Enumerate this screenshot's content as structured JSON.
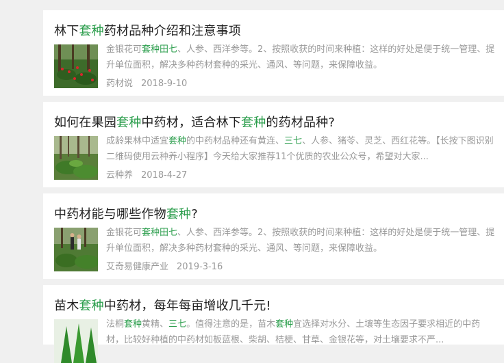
{
  "results": [
    {
      "title_parts": [
        {
          "t": "林下",
          "hl": false
        },
        {
          "t": "套种",
          "hl": true
        },
        {
          "t": "药材品种介绍和注意事项",
          "hl": false
        }
      ],
      "desc_parts": [
        {
          "t": "金银花可",
          "hl": false
        },
        {
          "t": "套种田七",
          "hl": true
        },
        {
          "t": "、人参、西洋参等。2、按照收获的时间来种植：这样的好处是便于统一管理、提升单位面积，解决多种药材套种的采光、通风、等问题，来保障收益。",
          "hl": false
        }
      ],
      "source": "药材说",
      "date": "2018-9-10",
      "thumb": "forest-redflowers"
    },
    {
      "title_parts": [
        {
          "t": "如何在果园",
          "hl": false
        },
        {
          "t": "套种",
          "hl": true
        },
        {
          "t": "中药材，适合林下",
          "hl": false
        },
        {
          "t": "套种",
          "hl": true
        },
        {
          "t": "的药材品种?",
          "hl": false
        }
      ],
      "desc_parts": [
        {
          "t": "成龄果林中适宜",
          "hl": false
        },
        {
          "t": "套种",
          "hl": true
        },
        {
          "t": "的中药材品种还有黄连、",
          "hl": false
        },
        {
          "t": "三七",
          "hl": true
        },
        {
          "t": "、人参、猪苓、灵芝、西红花等。【长按下图识别二维码使用云种养小程序】今天给大家推荐11个优质的农业公众号，希望对大家...",
          "hl": false
        }
      ],
      "source": "云种养",
      "date": "2018-4-27",
      "thumb": "forest-plants"
    },
    {
      "title_parts": [
        {
          "t": "中药材能与哪些作物",
          "hl": false
        },
        {
          "t": "套种",
          "hl": true
        },
        {
          "t": "?",
          "hl": false
        }
      ],
      "desc_parts": [
        {
          "t": "金银花可",
          "hl": false
        },
        {
          "t": "套种田七",
          "hl": true
        },
        {
          "t": "、人参、西洋参等。2、按照收获的时间来种植：这样的好处是便于统一管理、提升单位面积，解决多种药材套种的采光、通风、等问题，来保障收益。",
          "hl": false
        }
      ],
      "source": "艾奇易健康产业",
      "date": "2019-3-16",
      "thumb": "forest-people"
    },
    {
      "title_parts": [
        {
          "t": "苗木",
          "hl": false
        },
        {
          "t": "套种",
          "hl": true
        },
        {
          "t": "中药材，每年每亩增收几千元!",
          "hl": false
        }
      ],
      "desc_parts": [
        {
          "t": "法桐",
          "hl": false
        },
        {
          "t": "套种",
          "hl": true
        },
        {
          "t": "黄精、",
          "hl": false
        },
        {
          "t": "三七",
          "hl": true
        },
        {
          "t": "。值得注意的是，苗木",
          "hl": false
        },
        {
          "t": "套种",
          "hl": true
        },
        {
          "t": "宜选择对水分、土壤等生态因子要求相近的中药材，比较好种植的中药材如板蓝根、柴胡、桔梗、甘草、金银花等，对土壤要求不严...",
          "hl": false
        }
      ],
      "source": "",
      "date": "",
      "thumb": "nursery-trees"
    }
  ]
}
